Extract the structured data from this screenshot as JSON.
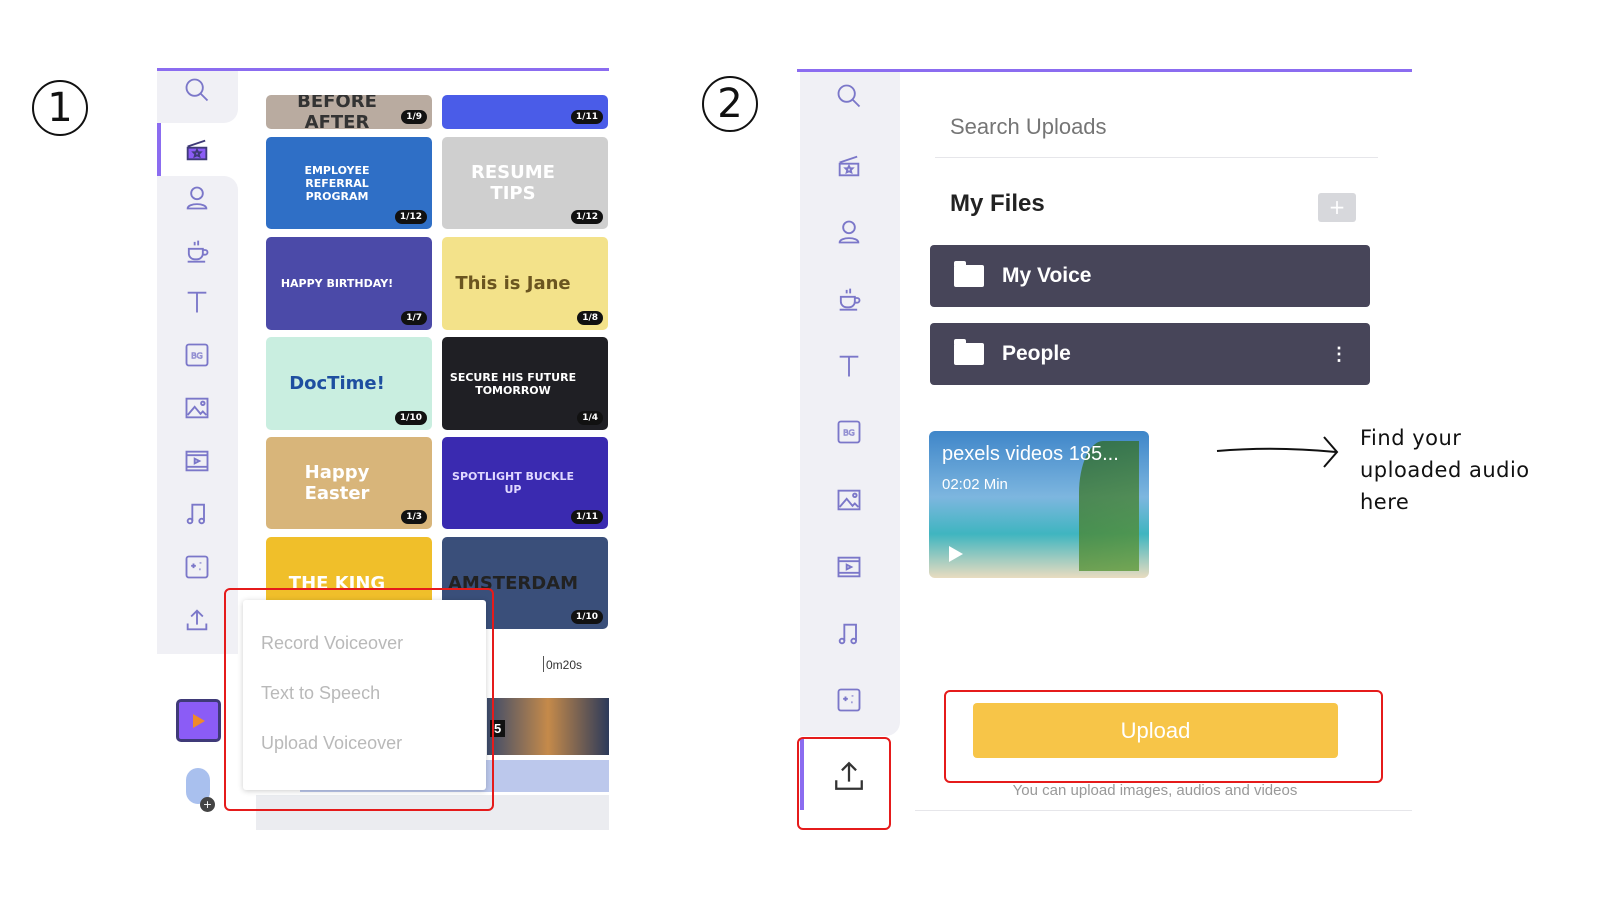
{
  "steps": {
    "one": "1",
    "two": "2"
  },
  "panel1": {
    "thumbnails": [
      {
        "title": "BEFORE   AFTER",
        "badge": "1/9",
        "bg": "#b9aba0",
        "fg": "#333"
      },
      {
        "title": "",
        "badge": "1/11",
        "bg": "#4a5ce8",
        "fg": "#fff"
      },
      {
        "title": "EMPLOYEE REFERRAL PROGRAM",
        "badge": "1/12",
        "bg": "#2f6fc6",
        "fg": "#fff"
      },
      {
        "title": "RESUME TIPS",
        "badge": "1/12",
        "bg": "#cfcfcf",
        "fg": "#fff"
      },
      {
        "title": "HAPPY BIRTHDAY!",
        "badge": "1/7",
        "bg": "#4b4aa8",
        "fg": "#fff"
      },
      {
        "title": "This is Jane",
        "badge": "1/8",
        "bg": "#f3e28a",
        "fg": "#6b5520"
      },
      {
        "title": "DocTime!",
        "badge": "1/10",
        "bg": "#c9eee0",
        "fg": "#1e4fa0"
      },
      {
        "title": "SECURE HIS FUTURE TOMORROW",
        "badge": "1/4",
        "bg": "#1f1f24",
        "fg": "#fff"
      },
      {
        "title": "Happy Easter",
        "badge": "1/3",
        "bg": "#d8b57a",
        "fg": "#fff"
      },
      {
        "title": "SPOTLIGHT BUCKLE UP",
        "badge": "1/11",
        "bg": "#3a2ab0",
        "fg": "#e0d8ff"
      },
      {
        "title": "THE KING",
        "badge": "",
        "bg": "#f0bf2a",
        "fg": "#fff"
      },
      {
        "title": "AMSTERDAM",
        "badge": "1/10",
        "bg": "#3a4f7a",
        "fg": "#222"
      }
    ],
    "timeline_marker": "0m20s",
    "scene_number": "5",
    "menu": [
      "Record Voiceover",
      "Text to Speech",
      "Upload Voiceover"
    ]
  },
  "panel2": {
    "search_placeholder": "Search Uploads",
    "my_files": "My Files",
    "folders": [
      "My Voice",
      "People"
    ],
    "video": {
      "title": "pexels videos 185...",
      "duration": "02:02 Min"
    },
    "upload_label": "Upload",
    "upload_note": "You can upload images, audios and videos",
    "annotation": "Find your uploaded audio here"
  },
  "colors": {
    "accent": "#8b6cf0",
    "upload": "#f7c548",
    "folder": "#474559",
    "highlight": "#e51b1b"
  }
}
